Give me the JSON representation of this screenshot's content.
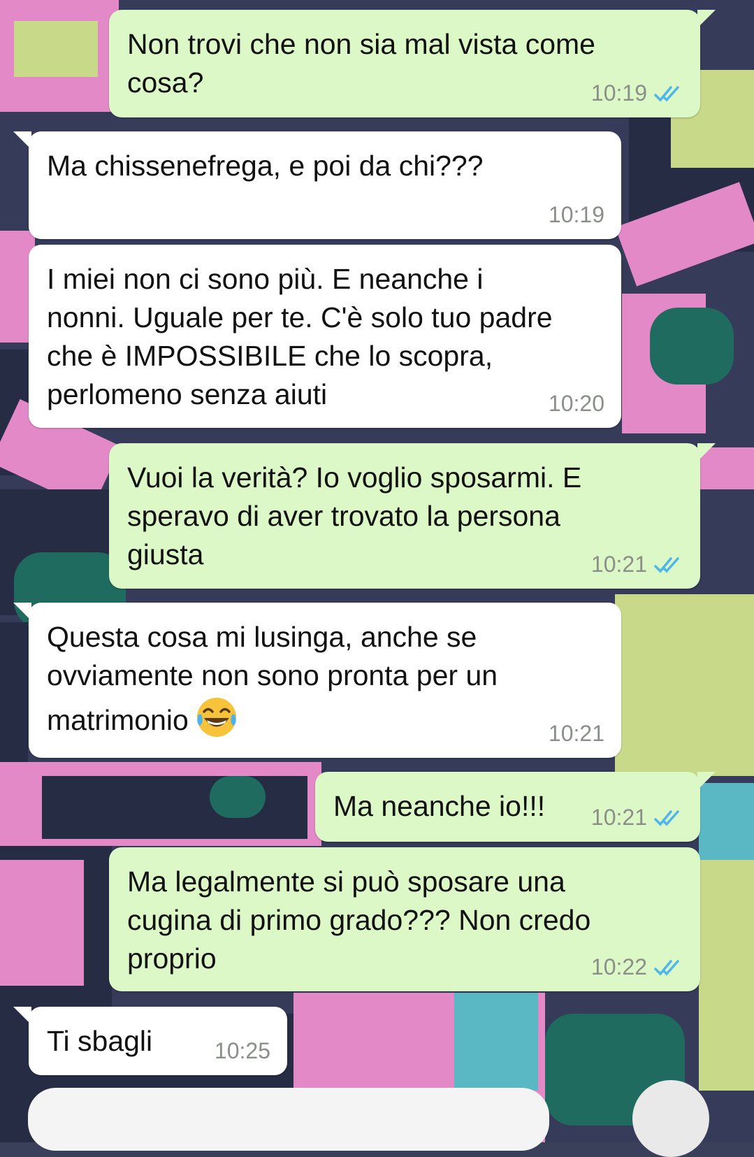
{
  "messages": [
    {
      "id": "m1",
      "direction": "outgoing",
      "text": "Non trovi che non sia mal vista come\ncosa?",
      "time": "10:19",
      "status": "read"
    },
    {
      "id": "m2",
      "direction": "incoming",
      "text": "Ma chissenefrega, e poi da chi???",
      "time": "10:19"
    },
    {
      "id": "m3",
      "direction": "incoming",
      "text": "I miei non ci sono più. E neanche i\nnonni. Uguale per te. C'è solo tuo padre\nche è IMPOSSIBILE che lo scopra,\nperlomeno senza aiuti",
      "time": "10:20"
    },
    {
      "id": "m4",
      "direction": "outgoing",
      "text": "Vuoi la verità? Io voglio sposarmi. E\nsperavo di aver trovato la persona\ngiusta",
      "time": "10:21",
      "status": "read"
    },
    {
      "id": "m5",
      "direction": "incoming",
      "text_line1": "Questa cosa mi lusinga, anche se",
      "text_line2": "ovviamente non sono pronta per un",
      "text_line3": "matrimonio",
      "emoji": "face-with-tears-of-joy",
      "time": "10:21"
    },
    {
      "id": "m6",
      "direction": "outgoing",
      "text": "Ma neanche io!!!",
      "time": "10:21",
      "status": "read"
    },
    {
      "id": "m7",
      "direction": "outgoing",
      "text": "Ma legalmente si può sposare una\ncugina di primo grado??? Non credo\nproprio",
      "time": "10:22",
      "status": "read"
    },
    {
      "id": "m8",
      "direction": "incoming",
      "text": "Ti sbagli",
      "time": "10:25"
    }
  ],
  "colors": {
    "outgoing_bubble": "#dcf8c6",
    "incoming_bubble": "#ffffff",
    "read_ticks": "#4fb6ec",
    "time_text": "#8a8f8a"
  }
}
